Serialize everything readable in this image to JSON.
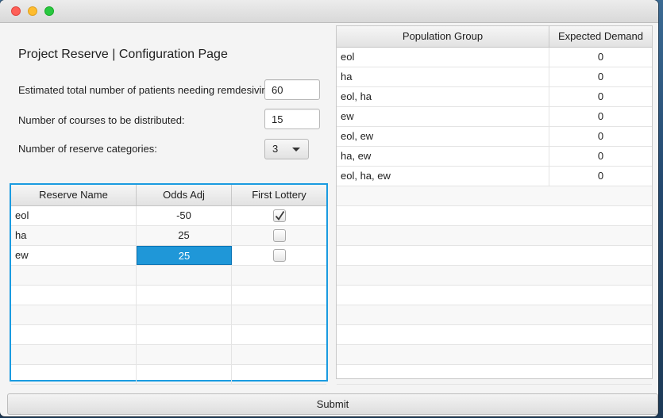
{
  "window": {
    "title": ""
  },
  "page": {
    "title": "Project Reserve | Configuration Page"
  },
  "form": {
    "patients_label": "Estimated total number of patients needing remdesivir:",
    "patients_value": "60",
    "courses_label": "Number of courses to be distributed:",
    "courses_value": "15",
    "categories_label": "Number of reserve categories:",
    "categories_value": "3"
  },
  "reserve_table": {
    "headers": [
      "Reserve Name",
      "Odds Adj",
      "First Lottery"
    ],
    "rows": [
      {
        "name": "eol",
        "odds": "-50",
        "first_lottery": true
      },
      {
        "name": "ha",
        "odds": "25",
        "first_lottery": false
      },
      {
        "name": "ew",
        "odds": "25",
        "first_lottery": false
      }
    ],
    "selected_cell": "row 3, Odds Adj"
  },
  "population_table": {
    "headers": [
      "Population Group",
      "Expected Demand"
    ],
    "rows": [
      {
        "group": "eol",
        "demand": "0"
      },
      {
        "group": "ha",
        "demand": "0"
      },
      {
        "group": "eol, ha",
        "demand": "0"
      },
      {
        "group": "ew",
        "demand": "0"
      },
      {
        "group": "eol, ew",
        "demand": "0"
      },
      {
        "group": "ha, ew",
        "demand": "0"
      },
      {
        "group": "eol, ha, ew",
        "demand": "0"
      }
    ]
  },
  "submit": {
    "label": "Submit"
  },
  "colors": {
    "selection": "#1f97d8",
    "focus_border": "#1a9be0"
  },
  "icons": {
    "checkbox_checked": "checkmark-icon",
    "combo_arrow": "chevron-down-icon"
  }
}
